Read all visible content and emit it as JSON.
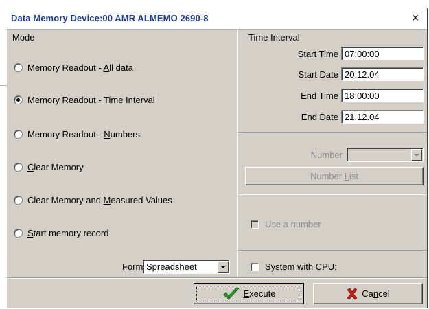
{
  "window": {
    "title": "Data Memory  Device:00  AMR ALMEMO 2690-8",
    "close_symbol": "×"
  },
  "mode": {
    "group_label": "Mode",
    "options": [
      {
        "pre": "Memory Readout - ",
        "acc": "A",
        "post": "ll data",
        "checked": false
      },
      {
        "pre": "Memory Readout - ",
        "acc": "T",
        "post": "ime Interval",
        "checked": true
      },
      {
        "pre": "Memory Readout - ",
        "acc": "N",
        "post": "umbers",
        "checked": false
      },
      {
        "pre": "",
        "acc": "C",
        "post": "lear Memory",
        "checked": false
      },
      {
        "pre": "Clear Memory and ",
        "acc": "M",
        "post": "easured Values",
        "checked": false
      },
      {
        "pre": "",
        "acc": "S",
        "post": "tart memory record",
        "checked": false
      }
    ],
    "format_label": "Format:",
    "format_value": "Spreadsheet"
  },
  "time_interval": {
    "group_label": "Time Interval",
    "start_time_label": "Start Time",
    "start_time": "07:00:00",
    "start_date_label": "Start Date",
    "start_date": "20.12.04",
    "end_time_label": "End Time",
    "end_time": "18:00:00",
    "end_date_label": "End Date",
    "end_date": "21.12.04"
  },
  "number": {
    "label": "Number",
    "value": "",
    "list_button_pre": "Number ",
    "list_button_acc": "L",
    "list_button_post": "ist",
    "use_number_label": "Use a number"
  },
  "cpu": {
    "label": "System with CPU:"
  },
  "buttons": {
    "execute_acc": "E",
    "execute_post": "xecute",
    "cancel_pre": "Ca",
    "cancel_acc": "n",
    "cancel_post": "cel"
  },
  "icons": {
    "execute": "checkmark-icon",
    "cancel": "red-x-icon",
    "check_color": "#2e9a2e",
    "x_color": "#c8201a"
  }
}
